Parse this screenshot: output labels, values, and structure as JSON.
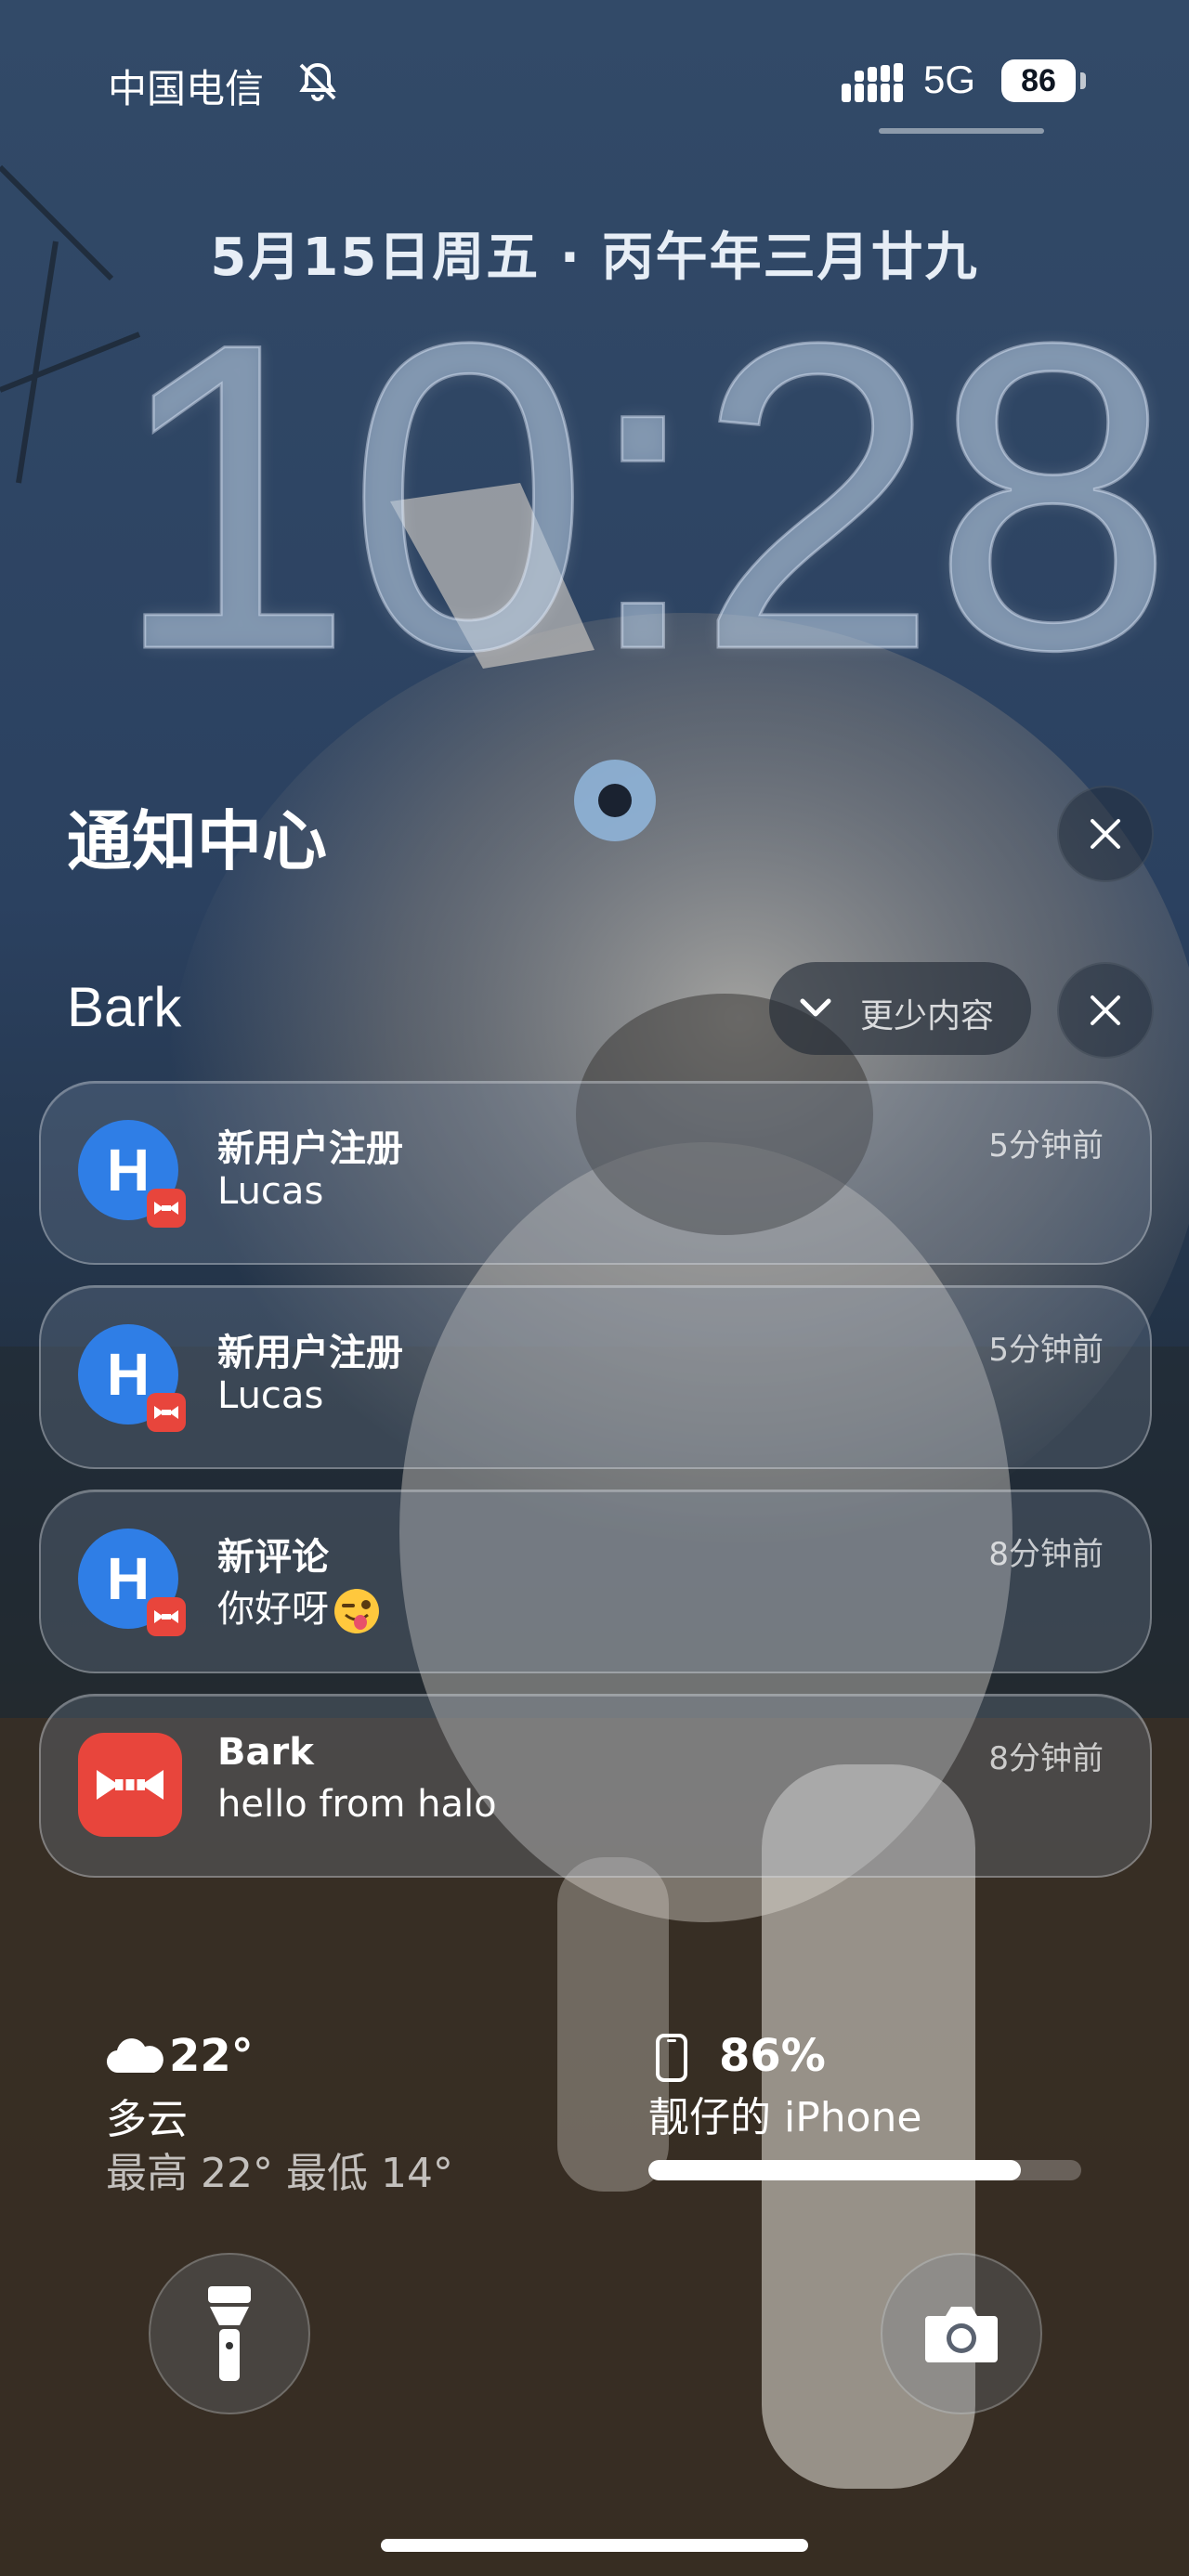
{
  "status_bar": {
    "carrier": "中国电信",
    "network": "5G",
    "battery_level": "86",
    "icons": [
      "bell-slash-icon",
      "signal-icon"
    ]
  },
  "lock_screen": {
    "date": "5月15日周五 · 丙午年三月廿九",
    "time": "10:28"
  },
  "notification_center": {
    "title": "通知中心",
    "group": {
      "app_name": "Bark",
      "show_less_label": "更少内容"
    },
    "notifications": [
      {
        "icon": "halo-app-icon",
        "title": "新用户注册",
        "body": "Lucas",
        "time": "5分钟前"
      },
      {
        "icon": "halo-app-icon",
        "title": "新用户注册",
        "body": "Lucas",
        "time": "5分钟前"
      },
      {
        "icon": "halo-app-icon",
        "title": "新评论",
        "body": "你好呀",
        "time": "8分钟前"
      },
      {
        "icon": "bark-app-icon",
        "title": "Bark",
        "body": "hello from halo",
        "time": "8分钟前"
      }
    ]
  },
  "widgets": {
    "weather": {
      "icon": "cloud-icon",
      "temperature": "22°",
      "condition": "多云",
      "range": "最高 22° 最低 14°"
    },
    "battery": {
      "icon": "iphone-icon",
      "percent": "86%",
      "device": "靓仔的 iPhone",
      "level": 0.86
    }
  },
  "colors": {
    "bark_red": "#e8453c",
    "halo_blue": "#2f7ee6"
  }
}
